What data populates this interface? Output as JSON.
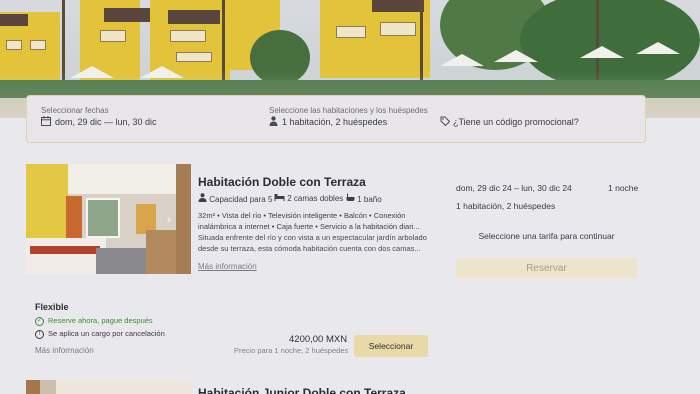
{
  "search": {
    "dates_label": "Seleccionar fechas",
    "dates_value": "dom, 29 dic — lun, 30 dic",
    "rooms_label": "Seleccione las habitaciones y los huéspedes",
    "rooms_value": "1 habitación, 2 huéspedes",
    "promo_link": "¿Tiene un código promocional?",
    "icons": [
      "calendar-icon",
      "person-icon",
      "tag-icon"
    ]
  },
  "room": {
    "title": "Habitación Doble con Terraza",
    "capacity": "Capacidad para 5",
    "beds": "2 camas dobles",
    "bath": "1 baño",
    "amenities": "32m²  •  Vista del río  •  Televisión inteligente  •  Balcón  •  Conexión inalámbrica a internet  •  Caja fuerte  •  Servicio a la habitación diari...",
    "description": "Situada enfrente del río y con vista a un espectacular jardín arbolado desde su terraza, esta cómoda habitación cuenta con dos camas...",
    "more_info": "Más información",
    "summary_dates": "dom, 29 dic 24 – lun, 30 dic 24",
    "summary_nights": "1 noche",
    "summary_guests": "1 habitación, 2 huéspedes",
    "select_rate_message": "Seleccione una tarifa para continuar",
    "reserve_button": "Reservar"
  },
  "rate": {
    "name": "Flexible",
    "policy_1": "Reserve ahora, pague después",
    "policy_2": "Se aplica un cargo por cancelación",
    "more_info": "Más información",
    "price": "4200,00 MXN",
    "price_note": "Precio para 1 noche, 2 huéspedes",
    "select_button": "Seleccionar"
  },
  "next_room": {
    "title": "Habitación Junior Doble con Terraza"
  },
  "colors": {
    "accent_gold": "#e9d9a7",
    "policy_green": "#3f8a3a",
    "page_bg": "#e9e8ec"
  }
}
